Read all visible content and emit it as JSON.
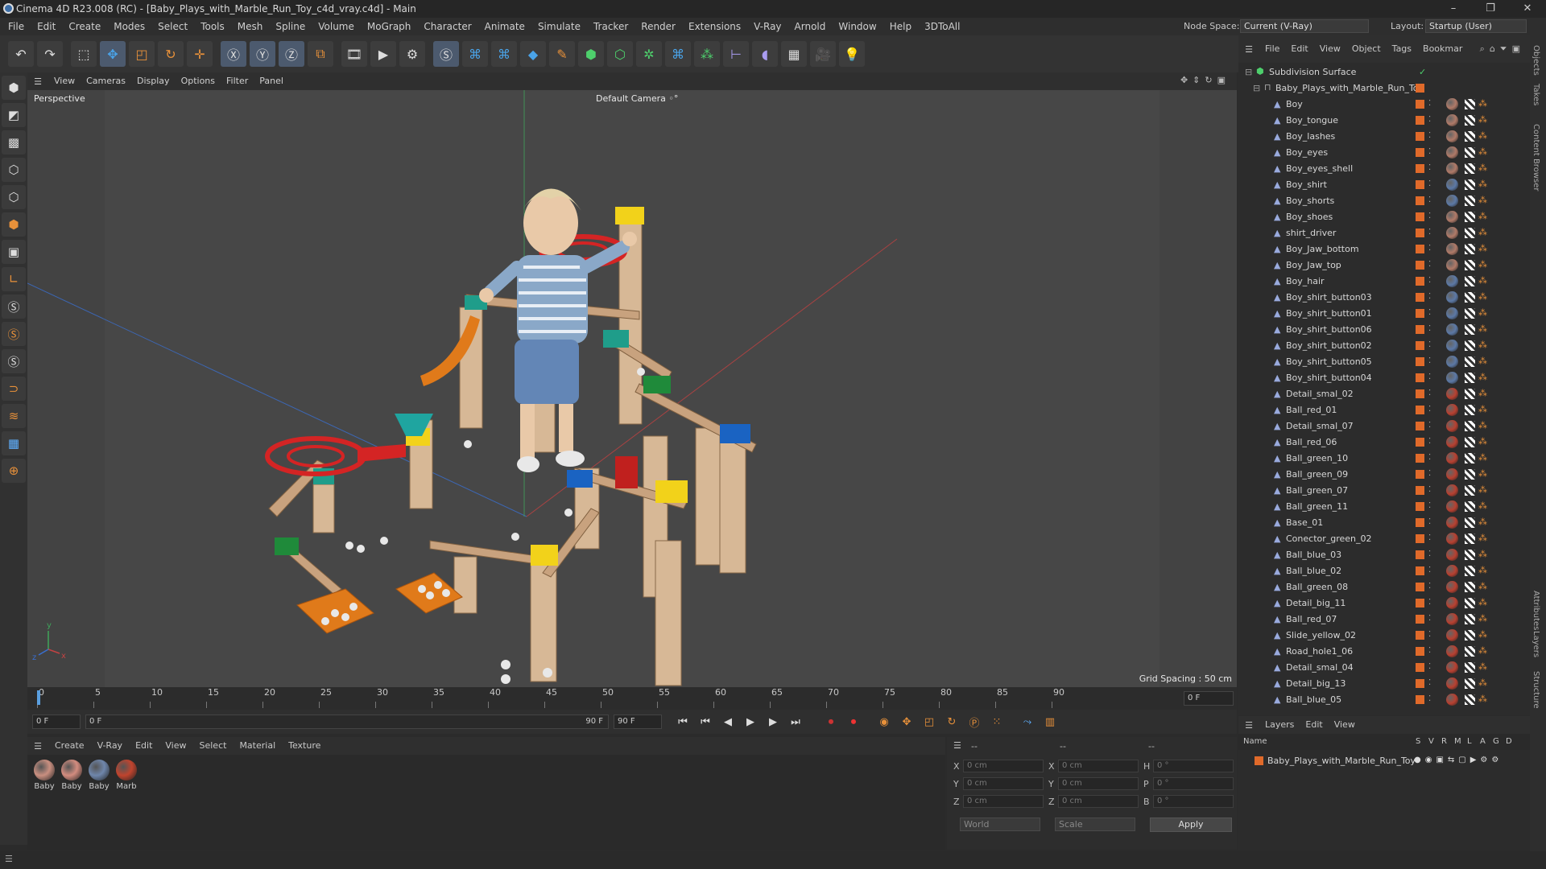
{
  "window": {
    "title": "Cinema 4D R23.008 (RC) - [Baby_Plays_with_Marble_Run_Toy_c4d_vray.c4d] - Main",
    "minimize": "–",
    "maximize": "❐",
    "close": "✕"
  },
  "menu": [
    "File",
    "Edit",
    "Create",
    "Modes",
    "Select",
    "Tools",
    "Mesh",
    "Spline",
    "Volume",
    "MoGraph",
    "Character",
    "Animate",
    "Simulate",
    "Tracker",
    "Render",
    "Extensions",
    "V-Ray",
    "Arnold",
    "Window",
    "Help",
    "3DToAll"
  ],
  "node_space": {
    "label": "Node Space:",
    "value": "Current (V-Ray)"
  },
  "layout": {
    "label": "Layout:",
    "value": "Startup (User)"
  },
  "toolbar_icons": [
    "undo-icon",
    "redo-icon",
    "select-icon",
    "move-icon",
    "scale-icon",
    "rotate-icon",
    "move-cross-icon",
    "axis-x-icon",
    "axis-y-icon",
    "axis-z-icon",
    "coord-icon",
    "render-region-icon",
    "render-view-icon",
    "render-settings-icon",
    "vray-icon",
    "python-icon",
    "python2-icon",
    "cube-icon",
    "pen-icon",
    "subdiv-icon",
    "extrude-icon",
    "cloner-icon",
    "python3-icon",
    "mograph-icon",
    "measure-icon",
    "deformer-icon",
    "floor-icon",
    "camera-icon",
    "light-icon"
  ],
  "viewport": {
    "menu": [
      "View",
      "Cameras",
      "Display",
      "Options",
      "Filter",
      "Panel"
    ],
    "label": "Perspective",
    "camera": "Default Camera",
    "camera_icon": "◦°",
    "grid_spacing": "Grid Spacing : 50 cm"
  },
  "timeline": {
    "ticks": [
      "0",
      "5",
      "10",
      "15",
      "20",
      "25",
      "30",
      "35",
      "40",
      "45",
      "50",
      "55",
      "60",
      "65",
      "70",
      "75",
      "80",
      "85",
      "90"
    ],
    "end_field": "0 F",
    "current": "0 F",
    "range_start": "0 F",
    "range_end": "90 F",
    "max": "90 F"
  },
  "material_manager": {
    "menu": [
      "Create",
      "V-Ray",
      "Edit",
      "View",
      "Select",
      "Material",
      "Texture"
    ],
    "materials": [
      {
        "name": "Baby",
        "color": "#c98f80"
      },
      {
        "name": "Baby",
        "color": "#d38c7f"
      },
      {
        "name": "Baby",
        "color": "#6f86ab"
      },
      {
        "name": "Marb",
        "color": "#c0442e"
      }
    ]
  },
  "coordinates": {
    "header_a": "--",
    "header_b": "--",
    "header_c": "--",
    "rows": [
      {
        "a": "X",
        "av": "0 cm",
        "b": "X",
        "bv": "0 cm",
        "c": "H",
        "cv": "0 °"
      },
      {
        "a": "Y",
        "av": "0 cm",
        "b": "Y",
        "bv": "0 cm",
        "c": "P",
        "cv": "0 °"
      },
      {
        "a": "Z",
        "av": "0 cm",
        "b": "Z",
        "bv": "0 cm",
        "c": "B",
        "cv": "0 °"
      }
    ],
    "mode": "World",
    "scale_mode": "Scale",
    "apply": "Apply"
  },
  "object_manager": {
    "menu": [
      "File",
      "Edit",
      "View",
      "Object",
      "Tags",
      "Bookmar"
    ],
    "root": "Subdivision Surface",
    "group": "Baby_Plays_with_Marble_Run_Toy",
    "objects": [
      {
        "name": "Boy",
        "mat": "#b07a68"
      },
      {
        "name": "Boy_tongue",
        "mat": "#b07a68"
      },
      {
        "name": "Boy_lashes",
        "mat": "#b07a68"
      },
      {
        "name": "Boy_eyes",
        "mat": "#b07a68"
      },
      {
        "name": "Boy_eyes_shell",
        "mat": "#b07a68"
      },
      {
        "name": "Boy_shirt",
        "mat": "#5c79a6"
      },
      {
        "name": "Boy_shorts",
        "mat": "#5c79a6"
      },
      {
        "name": "Boy_shoes",
        "mat": "#b07a68"
      },
      {
        "name": "shirt_driver",
        "mat": "#b07a68"
      },
      {
        "name": "Boy_Jaw_bottom",
        "mat": "#b07a68"
      },
      {
        "name": "Boy_Jaw_top",
        "mat": "#b07a68"
      },
      {
        "name": "Boy_hair",
        "mat": "#5c79a6"
      },
      {
        "name": "Boy_shirt_button03",
        "mat": "#5c79a6"
      },
      {
        "name": "Boy_shirt_button01",
        "mat": "#5c79a6"
      },
      {
        "name": "Boy_shirt_button06",
        "mat": "#5c79a6"
      },
      {
        "name": "Boy_shirt_button02",
        "mat": "#5c79a6"
      },
      {
        "name": "Boy_shirt_button05",
        "mat": "#5c79a6"
      },
      {
        "name": "Boy_shirt_button04",
        "mat": "#5c79a6"
      },
      {
        "name": "Detail_smal_02",
        "mat": "#b84030"
      },
      {
        "name": "Ball_red_01",
        "mat": "#b84030"
      },
      {
        "name": "Detail_smal_07",
        "mat": "#b84030"
      },
      {
        "name": "Ball_red_06",
        "mat": "#b84030"
      },
      {
        "name": "Ball_green_10",
        "mat": "#b84030"
      },
      {
        "name": "Ball_green_09",
        "mat": "#b84030"
      },
      {
        "name": "Ball_green_07",
        "mat": "#b84030"
      },
      {
        "name": "Ball_green_11",
        "mat": "#b84030"
      },
      {
        "name": "Base_01",
        "mat": "#b84030"
      },
      {
        "name": "Conector_green_02",
        "mat": "#b84030"
      },
      {
        "name": "Ball_blue_03",
        "mat": "#b84030"
      },
      {
        "name": "Ball_blue_02",
        "mat": "#b84030"
      },
      {
        "name": "Ball_green_08",
        "mat": "#b84030"
      },
      {
        "name": "Detail_big_11",
        "mat": "#b84030"
      },
      {
        "name": "Ball_red_07",
        "mat": "#b84030"
      },
      {
        "name": "Slide_yellow_02",
        "mat": "#b84030"
      },
      {
        "name": "Road_hole1_06",
        "mat": "#b84030"
      },
      {
        "name": "Detail_smal_04",
        "mat": "#b84030"
      },
      {
        "name": "Detail_big_13",
        "mat": "#b84030"
      },
      {
        "name": "Ball_blue_05",
        "mat": "#b84030"
      }
    ]
  },
  "right_tabs": [
    "Objects",
    "Takes",
    "Content Browser",
    "Attributes",
    "Layers",
    "Structure"
  ],
  "layers": {
    "menu": [
      "Layers",
      "Edit",
      "View"
    ],
    "header": "Name",
    "cols": [
      "S",
      "V",
      "R",
      "M",
      "L",
      "A",
      "G",
      "D"
    ],
    "items": [
      {
        "name": "Baby_Plays_with_Marble_Run_Toy",
        "color": "#e06a2a"
      }
    ]
  },
  "colors": {
    "accent": "#4c5a6e",
    "orange": "#e8913a"
  }
}
